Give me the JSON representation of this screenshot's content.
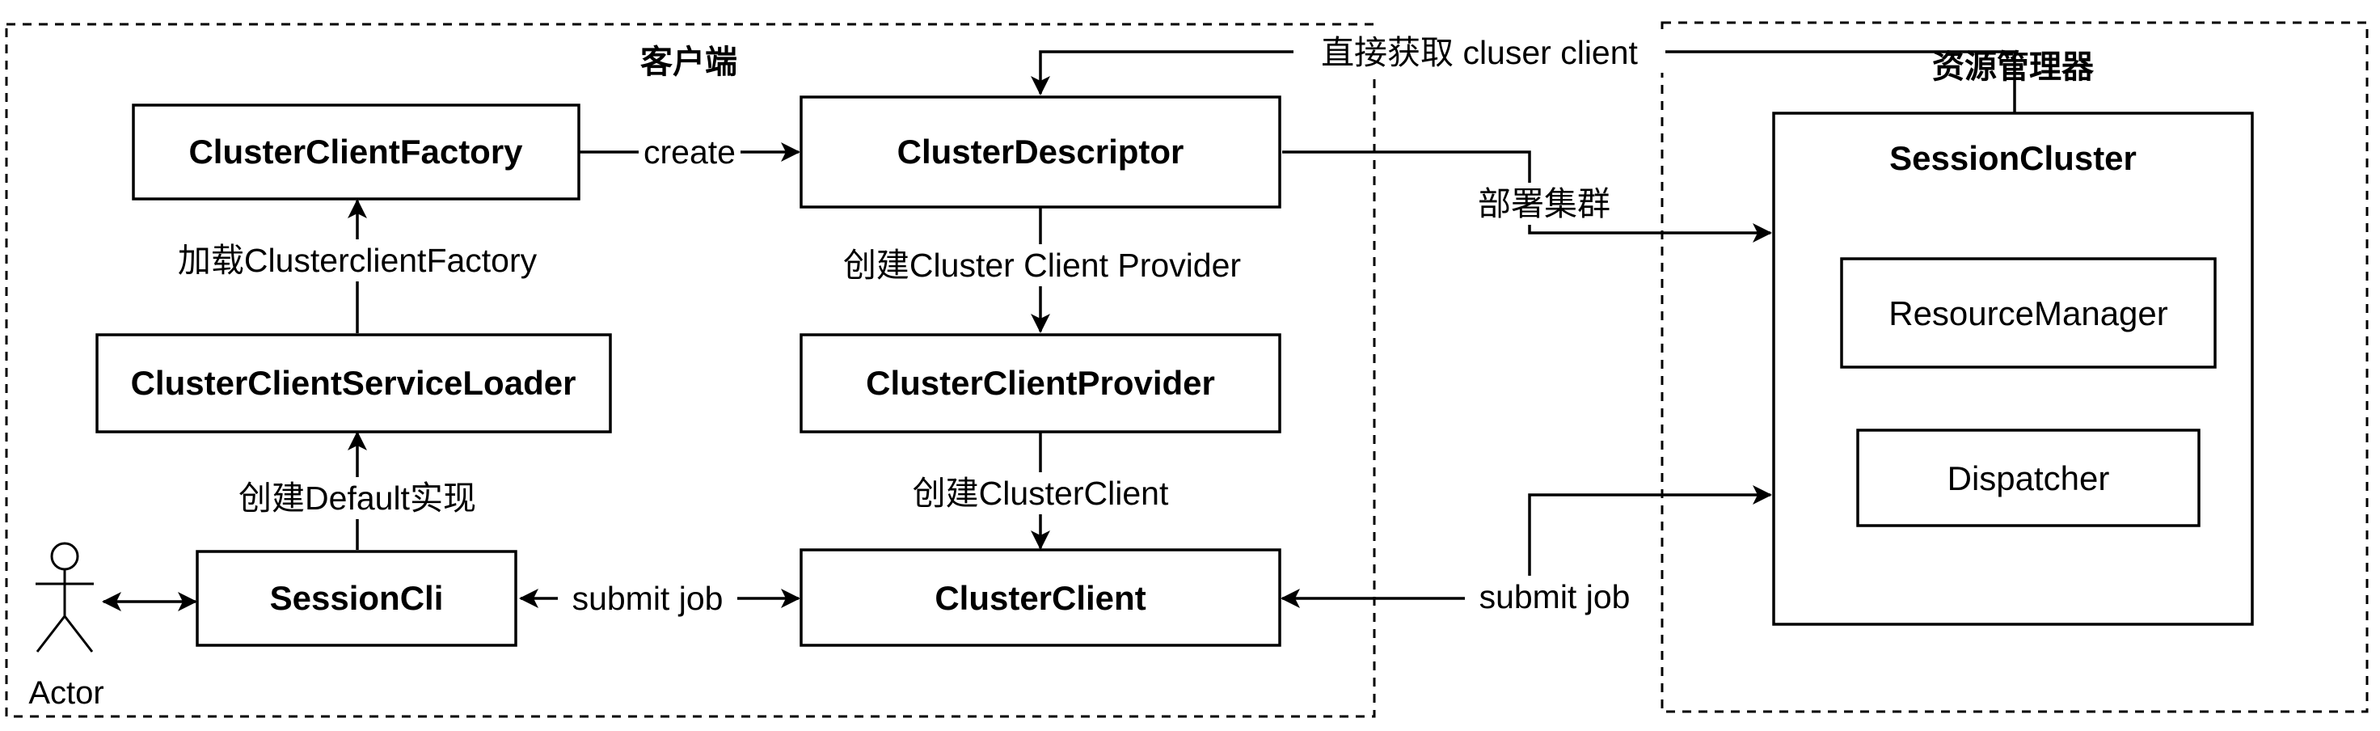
{
  "groups": {
    "client": "客户端",
    "resource_manager": "资源管理器"
  },
  "boxes": {
    "cluster_client_factory": "ClusterClientFactory",
    "cluster_descriptor": "ClusterDescriptor",
    "cluster_client_service_loader": "ClusterClientServiceLoader",
    "cluster_client_provider": "ClusterClientProvider",
    "session_cli": "SessionCli",
    "cluster_client": "ClusterClient",
    "session_cluster": "SessionCluster",
    "resource_manager": "ResourceManager",
    "dispatcher": "Dispatcher"
  },
  "actor": "Actor",
  "edges": {
    "create": "create",
    "direct_get": "直接获取 cluser client",
    "deploy_cluster": "部署集群",
    "create_provider": "创建Cluster Client Provider",
    "load_factory": "加载ClusterclientFactory",
    "create_default": "创建Default实现",
    "create_client": "创建ClusterClient",
    "submit_job_left": "submit job",
    "submit_job_right": "submit job"
  }
}
